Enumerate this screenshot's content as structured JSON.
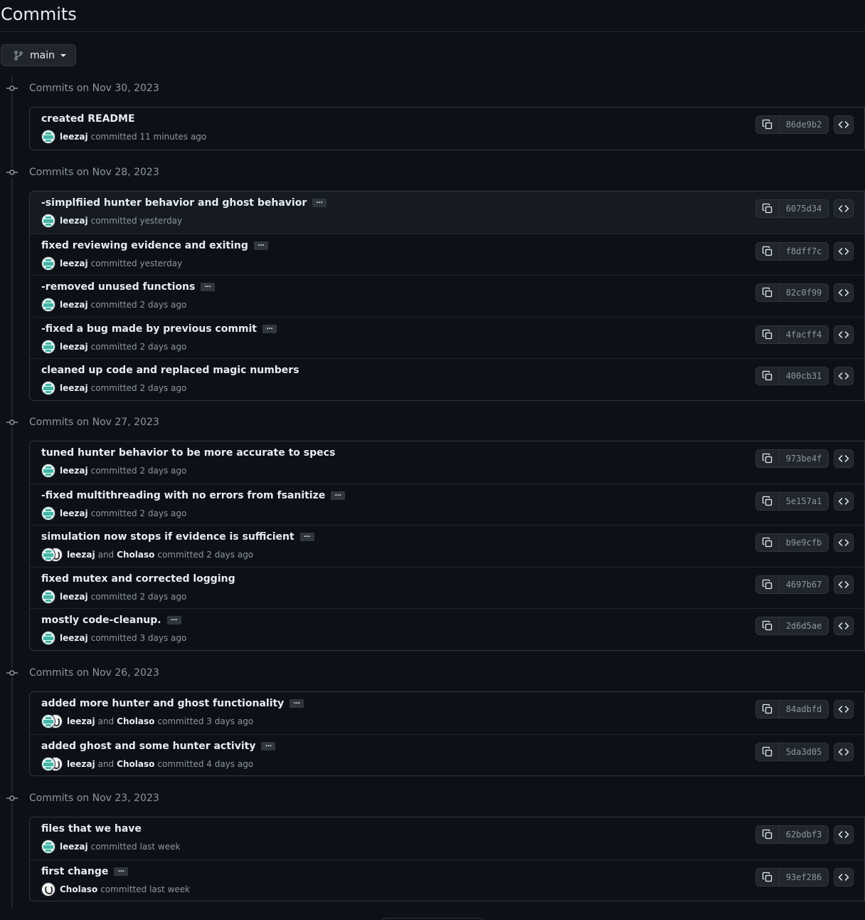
{
  "page": {
    "title": "Commits"
  },
  "branch": {
    "name": "main"
  },
  "groups": [
    {
      "date": "Commits on Nov 30, 2023",
      "commits": [
        {
          "message": "created README",
          "ellipsis": false,
          "authors": [
            "leezaj"
          ],
          "time": "committed 11 minutes ago",
          "sha": "86de9b2"
        }
      ]
    },
    {
      "date": "Commits on Nov 28, 2023",
      "commits": [
        {
          "message": "-simplfiied hunter behavior and ghost behavior",
          "ellipsis": true,
          "authors": [
            "leezaj"
          ],
          "time": "committed yesterday",
          "sha": "6075d34",
          "highlighted": true
        },
        {
          "message": "fixed reviewing evidence and exiting",
          "ellipsis": true,
          "authors": [
            "leezaj"
          ],
          "time": "committed yesterday",
          "sha": "f8dff7c"
        },
        {
          "message": "-removed unused functions",
          "ellipsis": true,
          "authors": [
            "leezaj"
          ],
          "time": "committed 2 days ago",
          "sha": "82c0f99"
        },
        {
          "message": "-fixed a bug made by previous commit",
          "ellipsis": true,
          "authors": [
            "leezaj"
          ],
          "time": "committed 2 days ago",
          "sha": "4facff4"
        },
        {
          "message": "cleaned up code and replaced magic numbers",
          "ellipsis": false,
          "authors": [
            "leezaj"
          ],
          "time": "committed 2 days ago",
          "sha": "400cb31"
        }
      ]
    },
    {
      "date": "Commits on Nov 27, 2023",
      "commits": [
        {
          "message": "tuned hunter behavior to be more accurate to specs",
          "ellipsis": false,
          "authors": [
            "leezaj"
          ],
          "time": "committed 2 days ago",
          "sha": "973be4f"
        },
        {
          "message": "-fixed multithreading with no errors from fsanitize",
          "ellipsis": true,
          "authors": [
            "leezaj"
          ],
          "time": "committed 2 days ago",
          "sha": "5e157a1"
        },
        {
          "message": "simulation now stops if evidence is sufficient",
          "ellipsis": true,
          "authors": [
            "leezaj",
            "Cholaso"
          ],
          "time": "committed 2 days ago",
          "sha": "b9e9cfb"
        },
        {
          "message": "fixed mutex and corrected logging",
          "ellipsis": false,
          "authors": [
            "leezaj"
          ],
          "time": "committed 2 days ago",
          "sha": "4697b67"
        },
        {
          "message": "mostly code-cleanup.",
          "ellipsis": true,
          "authors": [
            "leezaj"
          ],
          "time": "committed 3 days ago",
          "sha": "2d6d5ae"
        }
      ]
    },
    {
      "date": "Commits on Nov 26, 2023",
      "commits": [
        {
          "message": "added more hunter and ghost functionality",
          "ellipsis": true,
          "authors": [
            "leezaj",
            "Cholaso"
          ],
          "time": "committed 3 days ago",
          "sha": "84adbfd"
        },
        {
          "message": "added ghost and some hunter activity",
          "ellipsis": true,
          "authors": [
            "leezaj",
            "Cholaso"
          ],
          "time": "committed 4 days ago",
          "sha": "5da3d05"
        }
      ]
    },
    {
      "date": "Commits on Nov 23, 2023",
      "commits": [
        {
          "message": "files that we have",
          "ellipsis": false,
          "authors": [
            "leezaj"
          ],
          "time": "committed last week",
          "sha": "62bdbf3"
        },
        {
          "message": "first change",
          "ellipsis": true,
          "authors": [
            "Cholaso"
          ],
          "time": "committed last week",
          "sha": "93ef286"
        }
      ]
    }
  ],
  "labels": {
    "and": "and",
    "ellipsis": "…"
  },
  "icons": {
    "branch": "git-branch-icon",
    "commit": "git-commit-icon",
    "copy": "copy-icon",
    "browse": "code-icon"
  },
  "colors": {
    "background": "#0d1117",
    "border": "#30363d",
    "text": "#e6edf3",
    "muted": "#8d96a0"
  }
}
